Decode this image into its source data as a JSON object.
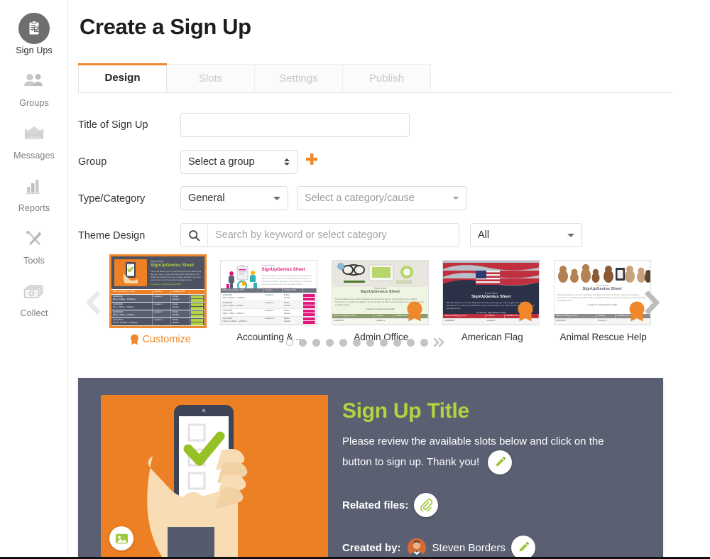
{
  "sidebar": {
    "items": [
      {
        "label": "Sign Ups",
        "icon": "clipboard-check-icon",
        "active": true
      },
      {
        "label": "Groups",
        "icon": "people-icon",
        "active": false
      },
      {
        "label": "Messages",
        "icon": "envelope-icon",
        "active": false
      },
      {
        "label": "Reports",
        "icon": "bar-chart-icon",
        "active": false
      },
      {
        "label": "Tools",
        "icon": "wrench-screwdriver-icon",
        "active": false
      },
      {
        "label": "Collect",
        "icon": "money-icon",
        "active": false
      }
    ]
  },
  "header": {
    "title": "Create a Sign Up"
  },
  "tabs": [
    {
      "label": "Design",
      "active": true
    },
    {
      "label": "Slots",
      "active": false
    },
    {
      "label": "Settings",
      "active": false
    },
    {
      "label": "Publish",
      "active": false
    }
  ],
  "form": {
    "title_label": "Title of Sign Up",
    "title_value": "",
    "title_placeholder": "",
    "group_label": "Group",
    "group_value": "Select a group",
    "add_group_icon": "plus-icon",
    "type_label": "Type/Category",
    "type_value": "General",
    "category_value": "Select a category/cause",
    "theme_label": "Theme Design",
    "theme_search_placeholder": "Search by keyword or select category",
    "theme_search_value": "",
    "theme_search_icon": "search-icon",
    "theme_filter_value": "All"
  },
  "carousel": {
    "prev_icon": "chevron-left-icon",
    "next_icon": "chevron-right-icon",
    "customize_label": "Customize",
    "customize_icon": "ribbon-icon",
    "themes": [
      {
        "name": "Customize",
        "selected": true,
        "badge": false,
        "hero": "orange-phone",
        "accent": "#ed8024"
      },
      {
        "name": "Accounting & ...",
        "selected": false,
        "badge": false,
        "hero": "accounting",
        "accent": "#e0197d"
      },
      {
        "name": "Admin Office",
        "selected": false,
        "badge": true,
        "hero": "desk",
        "accent": "#8a9b6e"
      },
      {
        "name": "American Flag",
        "selected": false,
        "badge": true,
        "hero": "flag",
        "accent": "#c0243a"
      },
      {
        "name": "Animal Rescue Help",
        "selected": false,
        "badge": true,
        "hero": "dogs",
        "accent": "#8c8c8c"
      }
    ],
    "pagination": {
      "total_dots": 11,
      "active_index": 0,
      "next_page_icon": "double-chevron-right-icon"
    }
  },
  "preview": {
    "title": "Sign Up Title",
    "description": "Please review the available slots below and click on the button to sign up. Thank you!",
    "edit_description_icon": "pencil-icon",
    "related_files_label": "Related files:",
    "attachment_icon": "paperclip-icon",
    "created_by_label": "Created by:",
    "created_by_name": "Steven Borders",
    "edit_creator_icon": "pencil-icon",
    "image_icon": "image-icon",
    "avatar_name": "avatar"
  },
  "colors": {
    "brand_orange": "#f0872b",
    "panel_slate": "#5a6072",
    "accent_green": "#b4d340",
    "image_orange": "#ed8024"
  }
}
